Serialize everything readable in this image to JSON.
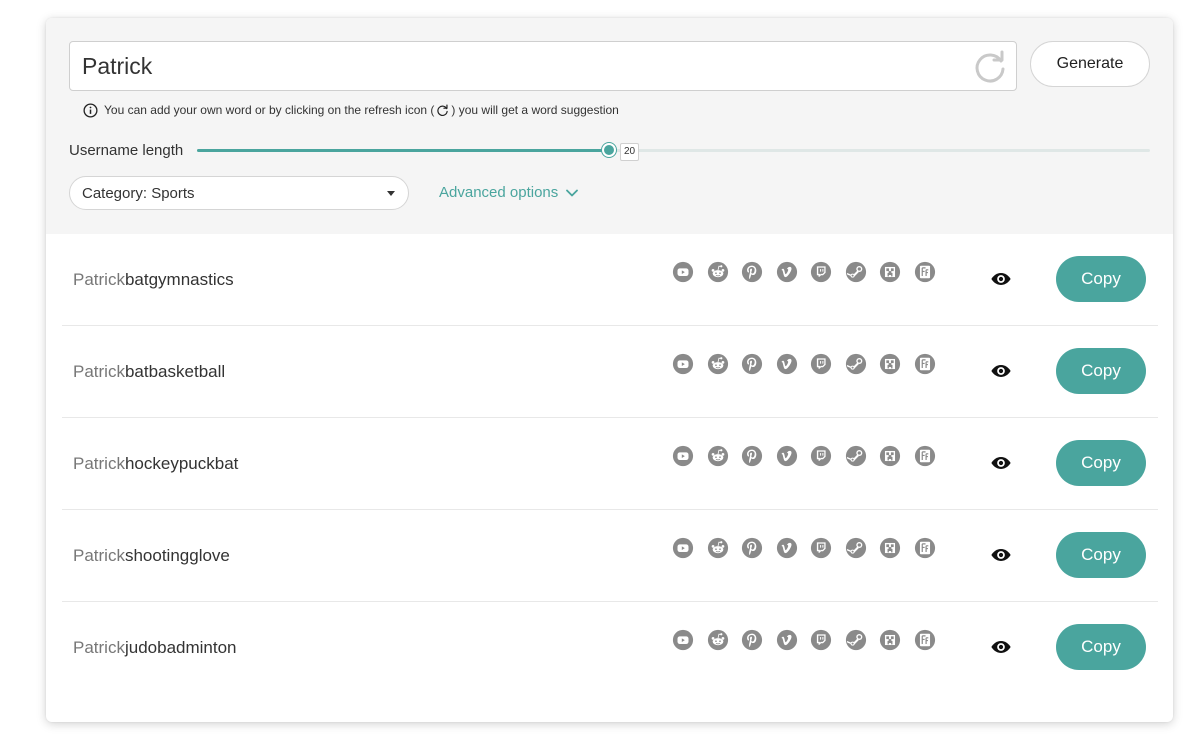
{
  "input": {
    "value": "Patrick"
  },
  "generate_label": "Generate",
  "hint": {
    "before": "You can add your own word or by clicking on the refresh icon (",
    "after": ") you will get a word suggestion"
  },
  "length": {
    "label": "Username length",
    "value": 20,
    "min": 1,
    "max": 45,
    "value_text": "20"
  },
  "category": {
    "label": "Category: Sports"
  },
  "advanced_label": "Advanced options",
  "accent_color": "#4aa59e",
  "copy_label": "Copy",
  "social_icons": [
    "youtube-icon",
    "reddit-icon",
    "pinterest-icon",
    "vimeo-icon",
    "twitch-icon",
    "steam-icon",
    "minecraft-icon",
    "fanfiction-icon"
  ],
  "results": [
    {
      "prefix": "Patrick",
      "suffix": "batgymnastics"
    },
    {
      "prefix": "Patrick",
      "suffix": "batbasketball"
    },
    {
      "prefix": "Patrick",
      "suffix": "hockeypuckbat"
    },
    {
      "prefix": "Patrick",
      "suffix": "shootingglove"
    },
    {
      "prefix": "Patrick",
      "suffix": "judobadminton"
    }
  ]
}
